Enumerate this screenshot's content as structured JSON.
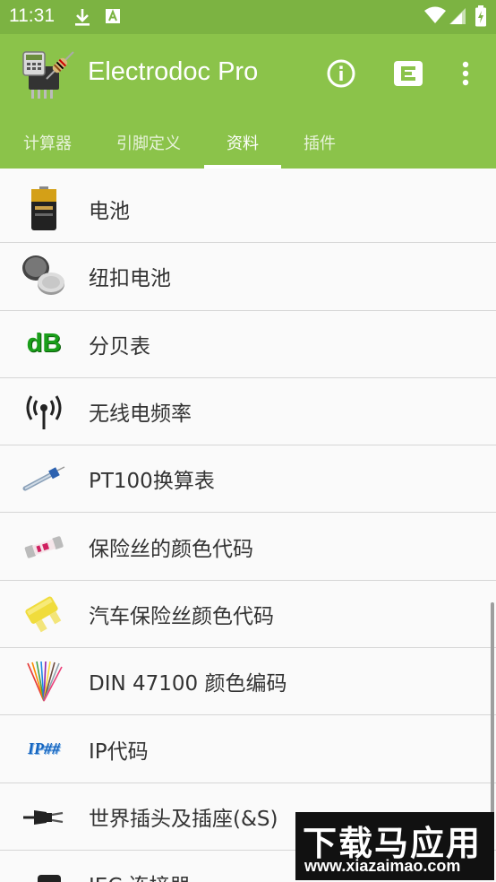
{
  "status_bar": {
    "time": "11:31",
    "icons": [
      "download-icon",
      "a-notification-icon",
      "wifi-icon",
      "signal-icon",
      "battery-icon"
    ]
  },
  "app_bar": {
    "title": "Electrodoc Pro",
    "actions": [
      "info-icon",
      "plugin-icon",
      "overflow-menu-icon"
    ],
    "background": "#8bc34a"
  },
  "tabs": [
    {
      "label": "计算器",
      "active": false
    },
    {
      "label": "引脚定义",
      "active": false
    },
    {
      "label": "资料",
      "active": true
    },
    {
      "label": "插件",
      "active": false
    }
  ],
  "list": [
    {
      "label": "电池",
      "icon": "battery-cell-icon"
    },
    {
      "label": "纽扣电池",
      "icon": "coin-cell-icon"
    },
    {
      "label": "分贝表",
      "icon": "decibel-icon",
      "icon_text": "dB"
    },
    {
      "label": "无线电频率",
      "icon": "radio-antenna-icon"
    },
    {
      "label": "PT100换算表",
      "icon": "pt100-sensor-icon"
    },
    {
      "label": "保险丝的颜色代码",
      "icon": "glass-fuse-icon"
    },
    {
      "label": "汽车保险丝颜色代码",
      "icon": "car-fuse-icon"
    },
    {
      "label": "DIN 47100 颜色编码",
      "icon": "wire-bundle-icon"
    },
    {
      "label": "IP代码",
      "icon": "ip-code-icon",
      "icon_text": "IP##"
    },
    {
      "label": "世界插头及插座(&S)",
      "icon": "power-plug-icon"
    },
    {
      "label": "IEC 连接器",
      "icon": "iec-connector-icon"
    }
  ],
  "watermark": {
    "title": "下载马应用",
    "url": "www.xiazaimao.com"
  }
}
